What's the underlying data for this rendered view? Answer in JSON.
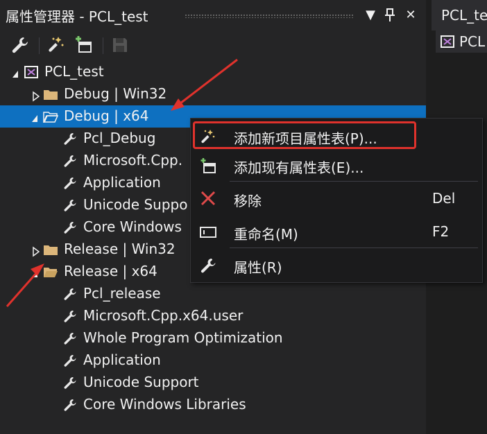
{
  "panel": {
    "title": "属性管理器 - PCL_test",
    "title_buttons": {
      "dropdown": "▼",
      "pin": "📌",
      "close": "✕"
    }
  },
  "toolbar": {
    "icons": [
      "wrench-icon",
      "wand-icon",
      "add-existing-icon",
      "save-icon"
    ]
  },
  "tree": {
    "root": "PCL_test",
    "nodes": [
      {
        "label": "Debug | Win32",
        "expanded": false,
        "selected": false,
        "children": []
      },
      {
        "label": "Debug | x64",
        "expanded": true,
        "selected": true,
        "children": [
          "Pcl_Debug",
          "Microsoft.Cpp.",
          "Application",
          "Unicode Suppo",
          "Core Windows"
        ]
      },
      {
        "label": "Release | Win32",
        "expanded": false,
        "selected": false,
        "children": []
      },
      {
        "label": "Release | x64",
        "expanded": true,
        "selected": false,
        "children": [
          "Pcl_release",
          "Microsoft.Cpp.x64.user",
          "Whole Program Optimization",
          "Application",
          "Unicode Support",
          "Core Windows Libraries"
        ]
      }
    ]
  },
  "right_tabs": {
    "tab1": "PCL_te",
    "tab2": "PCL"
  },
  "context_menu": {
    "items": [
      {
        "label": "添加新项目属性表(P)...",
        "shortcut": "",
        "icon": "wand-icon"
      },
      {
        "label": "添加现有属性表(E)...",
        "shortcut": "",
        "icon": "add-existing-icon"
      },
      {
        "label": "移除",
        "shortcut": "Del",
        "icon": "remove-icon"
      },
      {
        "label": "重命名(M)",
        "shortcut": "F2",
        "icon": "rename-icon"
      },
      {
        "label": "属性(R)",
        "shortcut": "",
        "icon": "wrench-icon"
      }
    ]
  },
  "colors": {
    "accent": "#0e70c0",
    "highlight_border": "#e0322c",
    "folder": "#dcb67a",
    "remove": "#e04a4a"
  }
}
